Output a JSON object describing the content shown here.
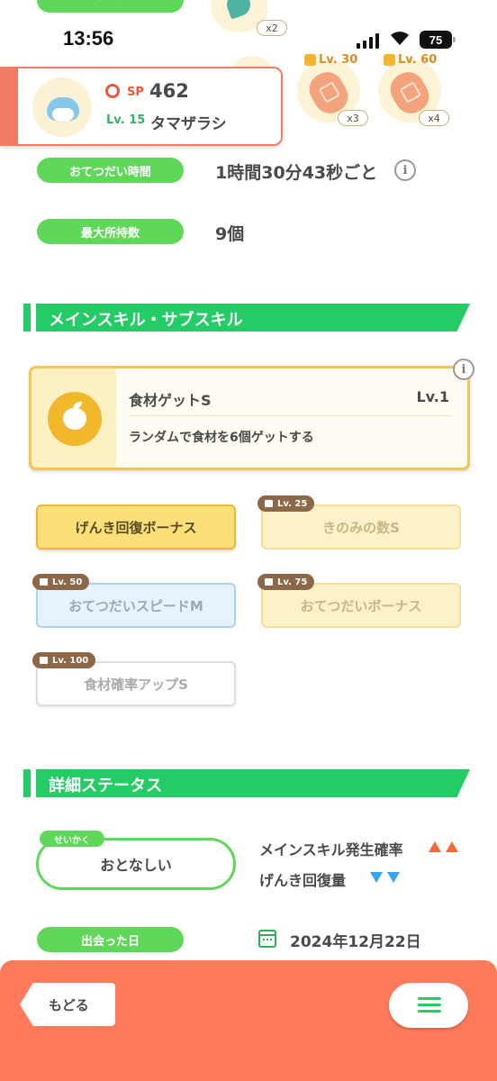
{
  "top": {
    "berry_label": "きのみ",
    "berry_count": "x2"
  },
  "status_bar": {
    "time": "13:56",
    "battery": "75"
  },
  "ingredients": [
    {
      "level": "Lv. 30",
      "count": "x3"
    },
    {
      "level": "Lv. 60",
      "count": "x4"
    }
  ],
  "pokemon": {
    "sp_label": "SP",
    "sp_value": "462",
    "level": "Lv. 15",
    "name": "タマザラシ"
  },
  "help_time": {
    "label": "おてつだい時間",
    "value": "1時間30分43秒ごと"
  },
  "max_inventory": {
    "label": "最大所持数",
    "value": "9個"
  },
  "skills_section": {
    "title": "メインスキル・サブスキル"
  },
  "main_skill": {
    "name": "食材ゲットS",
    "level": "Lv.1",
    "description": "ランダムで食材を6個ゲットする",
    "icon": "apple-icon"
  },
  "sub_skills": [
    {
      "label": "げんき回復ボーナス",
      "unlock": ""
    },
    {
      "label": "きのみの数S",
      "unlock": "Lv. 25"
    },
    {
      "label": "おてつだいスピードM",
      "unlock": "Lv. 50"
    },
    {
      "label": "おてつだいボーナス",
      "unlock": "Lv. 75"
    },
    {
      "label": "食材確率アップS",
      "unlock": "Lv. 100"
    }
  ],
  "details_section": {
    "title": "詳細ステータス"
  },
  "nature": {
    "tag": "せいかく",
    "value": "おとなしい",
    "up_stat": "メインスキル発生確率",
    "down_stat": "げんき回復量"
  },
  "met_date": {
    "label": "出会った日",
    "value": "2024年12月22日"
  },
  "footer": {
    "back_label": "もどる"
  },
  "colors": {
    "green": "#24cc66",
    "coral": "#ff7a5a",
    "gold": "#f3c653"
  }
}
